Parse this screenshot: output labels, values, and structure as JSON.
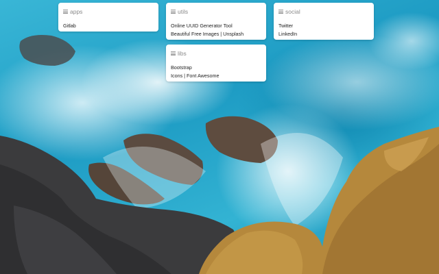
{
  "background": {
    "description": "",
    "colors": {
      "sea": "#2fa6c7",
      "rock_dark": "#3a3a3a",
      "rock_gold": "#b98a3a"
    }
  },
  "cards": [
    {
      "id": "apps",
      "title": "apps",
      "links": [
        "Gitlab"
      ]
    },
    {
      "id": "utils",
      "title": "utils",
      "links": [
        "Online UUID Generator Tool",
        "Beautiful Free Images | Unsplash"
      ]
    },
    {
      "id": "social",
      "title": "social",
      "links": [
        "Twitter",
        "LinkedIn"
      ]
    },
    {
      "id": "libs",
      "title": "libs",
      "links": [
        "Bootstrap",
        "Icons | Font Awesome"
      ]
    }
  ]
}
